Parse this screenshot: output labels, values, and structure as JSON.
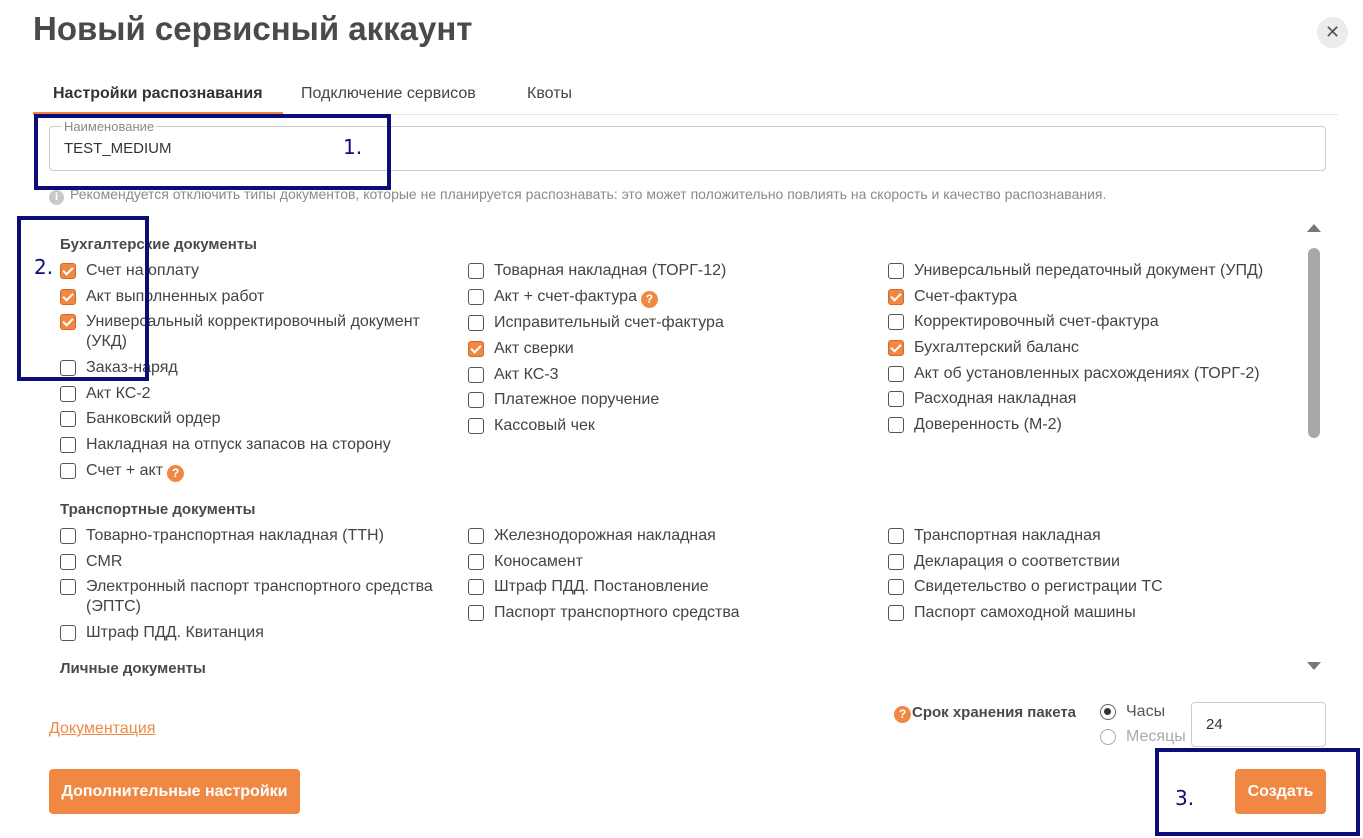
{
  "dialog": {
    "title": "Новый сервисный аккаунт",
    "close_glyph": "✕"
  },
  "tabs": [
    {
      "label": "Настройки распознавания",
      "active": true
    },
    {
      "label": "Подключение сервисов",
      "active": false
    },
    {
      "label": "Квоты",
      "active": false
    }
  ],
  "name_field": {
    "label": "Наименование",
    "value": "TEST_MEDIUM"
  },
  "hint": {
    "icon": "i",
    "text": "Рекомендуется отключить типы документов, которые не планируется распознавать: это может положительно повлиять на скорость и качество распознавания."
  },
  "sections": [
    {
      "title": "Бухгалтерские документы",
      "columns": [
        [
          {
            "label": "Счет на оплату",
            "checked": true
          },
          {
            "label": "Акт выполненных работ",
            "checked": true
          },
          {
            "label": "Универсальный корректировочный документ (УКД)",
            "checked": true
          },
          {
            "label": "Заказ-наряд",
            "checked": false
          },
          {
            "label": "Акт КС-2",
            "checked": false
          },
          {
            "label": "Банковский ордер",
            "checked": false
          },
          {
            "label": "Накладная на отпуск запасов на сторону",
            "checked": false
          },
          {
            "label": "Счет + акт",
            "checked": false,
            "help": "?"
          }
        ],
        [
          {
            "label": "Товарная накладная (ТОРГ-12)",
            "checked": false
          },
          {
            "label": "Акт + счет-фактура",
            "checked": false,
            "help": "?"
          },
          {
            "label": "Исправительный счет-фактура",
            "checked": false
          },
          {
            "label": "Акт сверки",
            "checked": true
          },
          {
            "label": "Акт КС-3",
            "checked": false
          },
          {
            "label": "Платежное поручение",
            "checked": false
          },
          {
            "label": "Кассовый чек",
            "checked": false
          }
        ],
        [
          {
            "label": "Универсальный передаточный документ (УПД)",
            "checked": false
          },
          {
            "label": "Счет-фактура",
            "checked": true
          },
          {
            "label": "Корректировочный счет-фактура",
            "checked": false
          },
          {
            "label": "Бухгалтерский баланс",
            "checked": true
          },
          {
            "label": "Акт об установленных расхождениях (ТОРГ-2)",
            "checked": false
          },
          {
            "label": "Расходная накладная",
            "checked": false
          },
          {
            "label": "Доверенность (М-2)",
            "checked": false
          }
        ]
      ]
    },
    {
      "title": "Транспортные документы",
      "columns": [
        [
          {
            "label": "Товарно-транспортная накладная (ТТН)",
            "checked": false
          },
          {
            "label": "CMR",
            "checked": false
          },
          {
            "label": "Электронный паспорт транспортного средства (ЭПТС)",
            "checked": false
          },
          {
            "label": "Штраф ПДД. Квитанция",
            "checked": false
          }
        ],
        [
          {
            "label": "Железнодорожная накладная",
            "checked": false
          },
          {
            "label": "Коносамент",
            "checked": false
          },
          {
            "label": "Штраф ПДД. Постановление",
            "checked": false
          },
          {
            "label": "Паспорт транспортного средства",
            "checked": false
          }
        ],
        [
          {
            "label": "Транспортная накладная",
            "checked": false
          },
          {
            "label": "Декларация о соответствии",
            "checked": false
          },
          {
            "label": "Свидетельство о регистрации ТС",
            "checked": false
          },
          {
            "label": "Паспорт самоходной машины",
            "checked": false
          }
        ]
      ]
    },
    {
      "title": "Личные документы",
      "columns": []
    }
  ],
  "footer": {
    "docs_link": "Документация",
    "storage": {
      "help": "?",
      "label": "Срок хранения пакета",
      "options": [
        {
          "label": "Часы",
          "selected": true
        },
        {
          "label": "Месяцы",
          "selected": false
        }
      ],
      "value": "24"
    },
    "extra_button": "Дополнительные настройки",
    "create_button": "Создать"
  },
  "annotations": [
    "1.",
    "2.",
    "3."
  ],
  "colors": {
    "accent": "#f08844",
    "annotation": "#0d0d7a",
    "title": "#4a4a4a"
  }
}
